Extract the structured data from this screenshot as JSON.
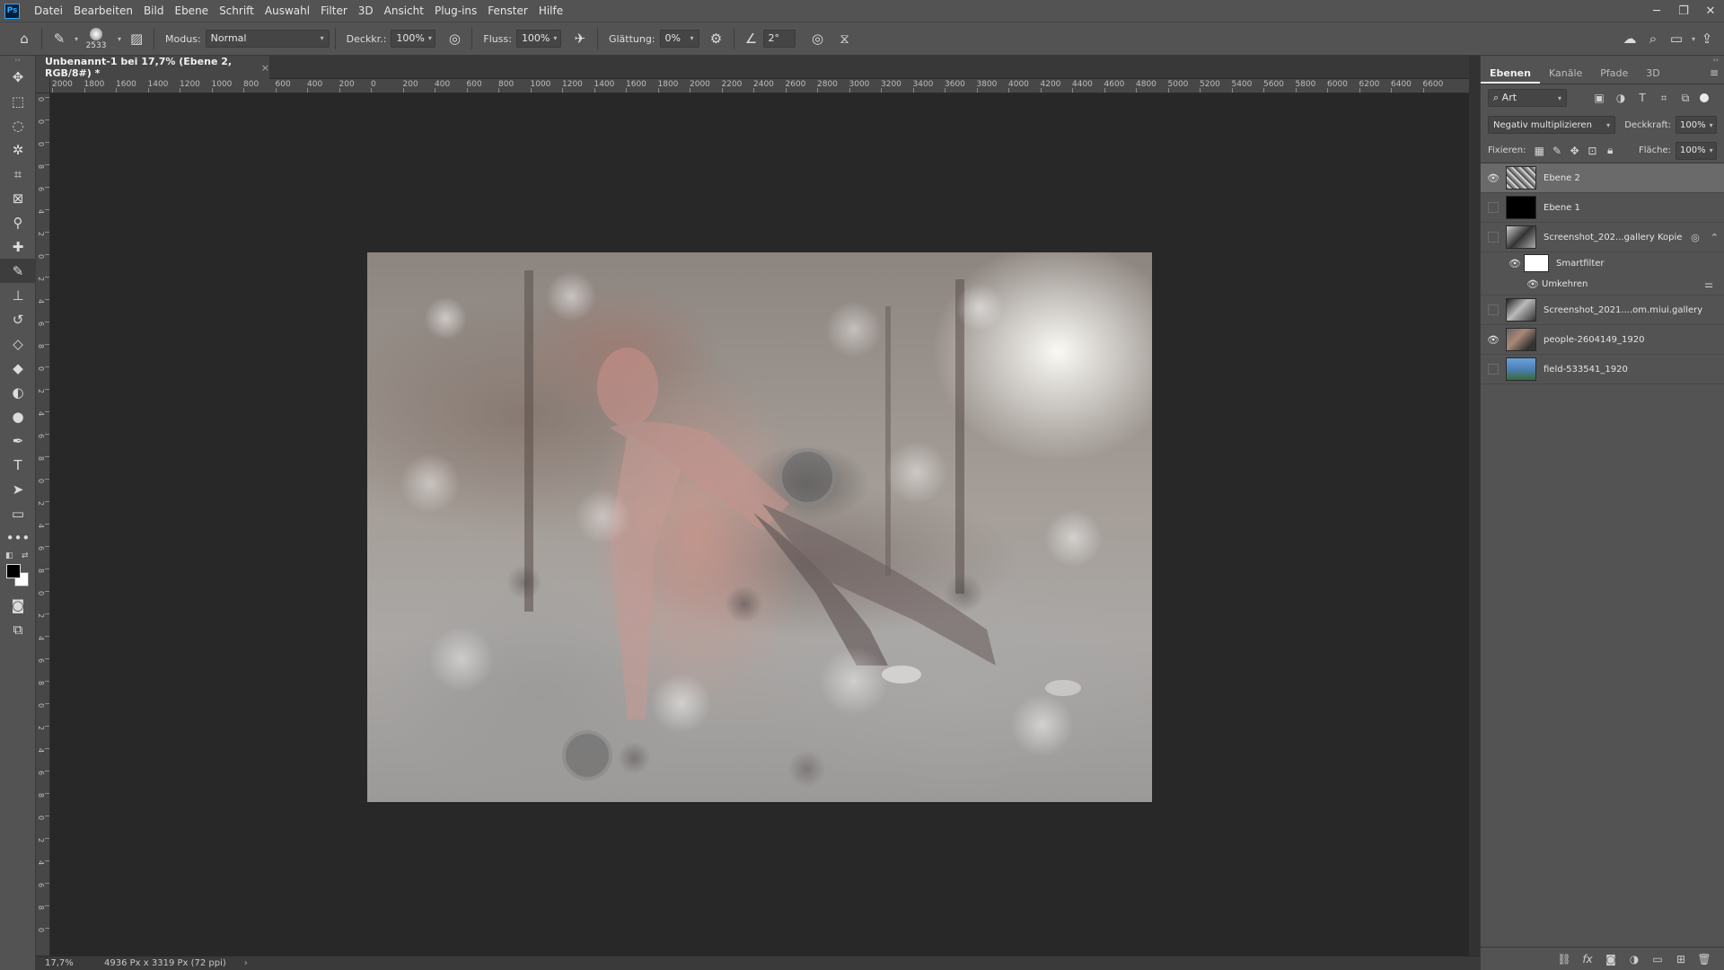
{
  "menu": {
    "items": [
      "Datei",
      "Bearbeiten",
      "Bild",
      "Ebene",
      "Schrift",
      "Auswahl",
      "Filter",
      "3D",
      "Ansicht",
      "Plug-ins",
      "Fenster",
      "Hilfe"
    ],
    "logo": "Ps"
  },
  "window": {
    "minimize": "─",
    "restore": "❐",
    "close": "✕"
  },
  "options": {
    "brush_size": "2533",
    "mode_label": "Modus:",
    "mode_value": "Normal",
    "opacity_label": "Deckkr.:",
    "opacity_value": "100%",
    "flow_label": "Fluss:",
    "flow_value": "100%",
    "smoothing_label": "Glättung:",
    "smoothing_value": "0%",
    "angle_value": "2°"
  },
  "document": {
    "tab_title": "Unbenannt-1 bei 17,7% (Ebene 2, RGB/8#) *",
    "close": "×"
  },
  "rulers": {
    "horizontal": [
      "2000",
      "1800",
      "1600",
      "1400",
      "1200",
      "1000",
      "800",
      "600",
      "400",
      "200",
      "0",
      "200",
      "400",
      "600",
      "800",
      "1000",
      "1200",
      "1400",
      "1600",
      "1800",
      "2000",
      "2200",
      "2400",
      "2600",
      "2800",
      "3000",
      "3200",
      "3400",
      "3600",
      "3800",
      "4000",
      "4200",
      "4400",
      "4600",
      "4800",
      "5000",
      "5200",
      "5400",
      "5600",
      "5800",
      "6000",
      "6200",
      "6400",
      "6600"
    ],
    "vertical": [
      "0",
      "0",
      "0",
      "8",
      "6",
      "4",
      "2",
      "0",
      "2",
      "4",
      "6",
      "8",
      "0",
      "2",
      "4",
      "6",
      "8",
      "0",
      "2",
      "4",
      "6",
      "8",
      "0",
      "2",
      "4",
      "6",
      "8",
      "0",
      "2",
      "4",
      "6",
      "8",
      "0",
      "2",
      "4",
      "6",
      "8",
      "0"
    ]
  },
  "status": {
    "zoom": "17,7%",
    "info": "4936 Px x 3319 Px (72 ppi)",
    "arrow": "›"
  },
  "panel": {
    "tabs": [
      "Ebenen",
      "Kanäle",
      "Pfade",
      "3D"
    ],
    "filter_value": "Art",
    "blend_mode": "Negativ multiplizieren",
    "opacity_label": "Deckkraft:",
    "opacity_value": "100%",
    "lock_label": "Fixieren:",
    "fill_label": "Fläche:",
    "fill_value": "100%",
    "layers": [
      {
        "name": "Ebene 2",
        "visible": true,
        "selected": true,
        "thumb": "noise"
      },
      {
        "name": "Ebene 1",
        "visible": false,
        "selected": false,
        "thumb": "black"
      },
      {
        "name": "Screenshot_202...gallery Kopie",
        "visible": false,
        "selected": false,
        "thumb": "photo1"
      },
      {
        "name": "Smartfilter",
        "visible": true,
        "selected": false,
        "thumb": "white"
      },
      {
        "name": "Umkehren",
        "visible": true,
        "selected": false,
        "thumb": "none"
      },
      {
        "name": "Screenshot_2021....om.miui.gallery",
        "visible": false,
        "selected": false,
        "thumb": "photo2"
      },
      {
        "name": "people-2604149_1920",
        "visible": true,
        "selected": false,
        "thumb": "photo3"
      },
      {
        "name": "field-533541_1920",
        "visible": false,
        "selected": false,
        "thumb": "field"
      }
    ]
  },
  "tools": [
    "move-tool",
    "marquee-tool",
    "lasso-tool",
    "magic-wand-tool",
    "crop-tool",
    "frame-tool",
    "eyedropper-tool",
    "healing-tool",
    "brush-tool",
    "stamp-tool",
    "history-brush-tool",
    "eraser-tool",
    "gradient-tool",
    "blur-tool",
    "dodge-tool",
    "pen-tool",
    "type-tool",
    "path-select-tool",
    "rectangle-tool",
    "more-tools"
  ],
  "colors": {
    "foreground": "#000000",
    "background": "#ffffff",
    "accent": "#31a8ff"
  }
}
